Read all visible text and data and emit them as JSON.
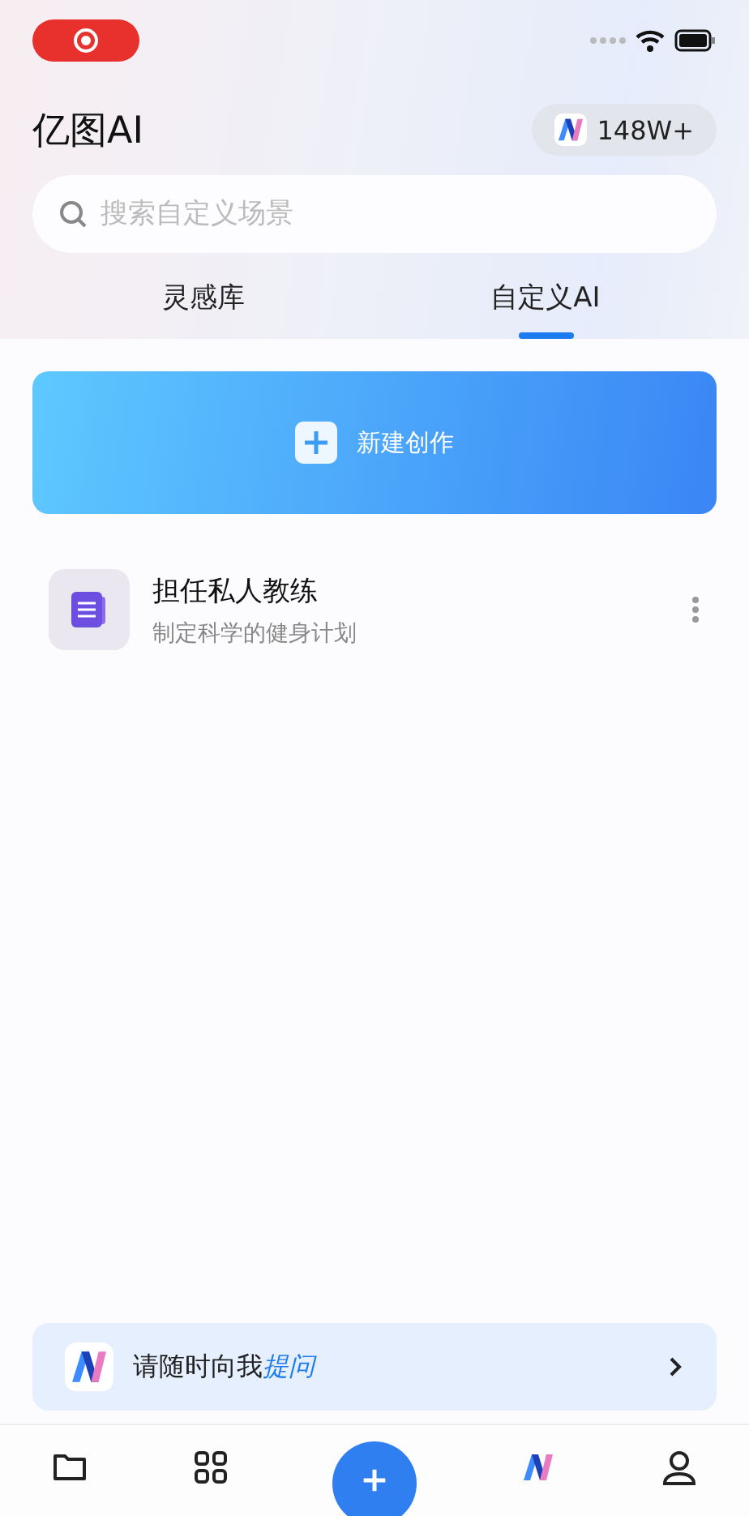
{
  "header": {
    "title": "亿图AI",
    "badge": "148W+"
  },
  "search": {
    "placeholder": "搜索自定义场景"
  },
  "tabs": [
    {
      "label": "灵感库",
      "selected": false
    },
    {
      "label": "自定义AI",
      "selected": true
    }
  ],
  "create_button": {
    "label": "新建创作"
  },
  "items": [
    {
      "title": "担任私人教练",
      "subtitle": "制定科学的健身计划"
    }
  ],
  "prompt": {
    "text": "请随时向我",
    "highlight": "提问"
  },
  "nav": [
    {
      "kind": "folder"
    },
    {
      "kind": "grid"
    },
    {
      "kind": "add"
    },
    {
      "kind": "logo"
    },
    {
      "kind": "profile"
    }
  ]
}
